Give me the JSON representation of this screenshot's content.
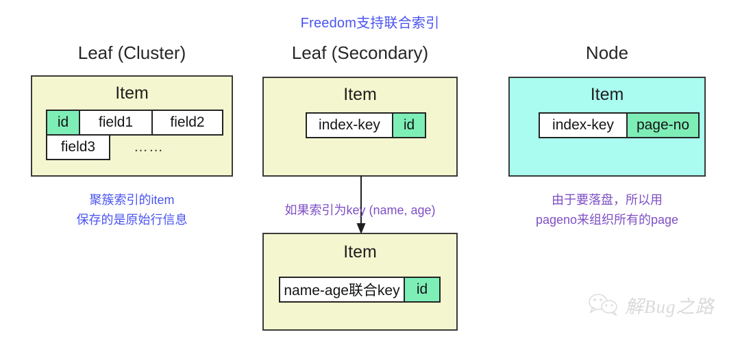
{
  "headline": "Freedom支持联合索引",
  "columns": [
    {
      "title": "Leaf (Cluster)",
      "item_label": "Item",
      "caption_line1": "聚簇索引的item",
      "caption_line2": "保存的是原始行信息",
      "cells_row1": [
        "id",
        "field1",
        "field2"
      ],
      "cells_row2": [
        "field3"
      ],
      "ellipsis": "……"
    },
    {
      "title": "Leaf (Secondary)",
      "item_label": "Item",
      "caption_line1": "如果索引为key (name, age)",
      "cells_row1": [
        "index-key",
        "id"
      ]
    },
    {
      "title": "Node",
      "item_label": "Item",
      "caption_line1": "由于要落盘，所以用",
      "caption_line2": "pageno来组织所有的page",
      "cells_row1": [
        "index-key",
        "page-no"
      ]
    }
  ],
  "composite_box": {
    "item_label": "Item",
    "cells_row1": [
      "name-age联合key",
      "id"
    ]
  },
  "watermark": {
    "text": "解Bug之路",
    "icon": "wechat-icon"
  },
  "colors": {
    "headline": "#4a54f0",
    "caption_blue": "#4a54f0",
    "caption_purple": "#7e4fc4",
    "box_yellow": "#f4f6cf",
    "box_cyan": "#aafbf0",
    "cell_green": "#7eeeb7",
    "cell_white": "#ffffff",
    "border": "#3a3a38",
    "text": "#1a1a1a",
    "watermark": "#d9d9d9"
  }
}
